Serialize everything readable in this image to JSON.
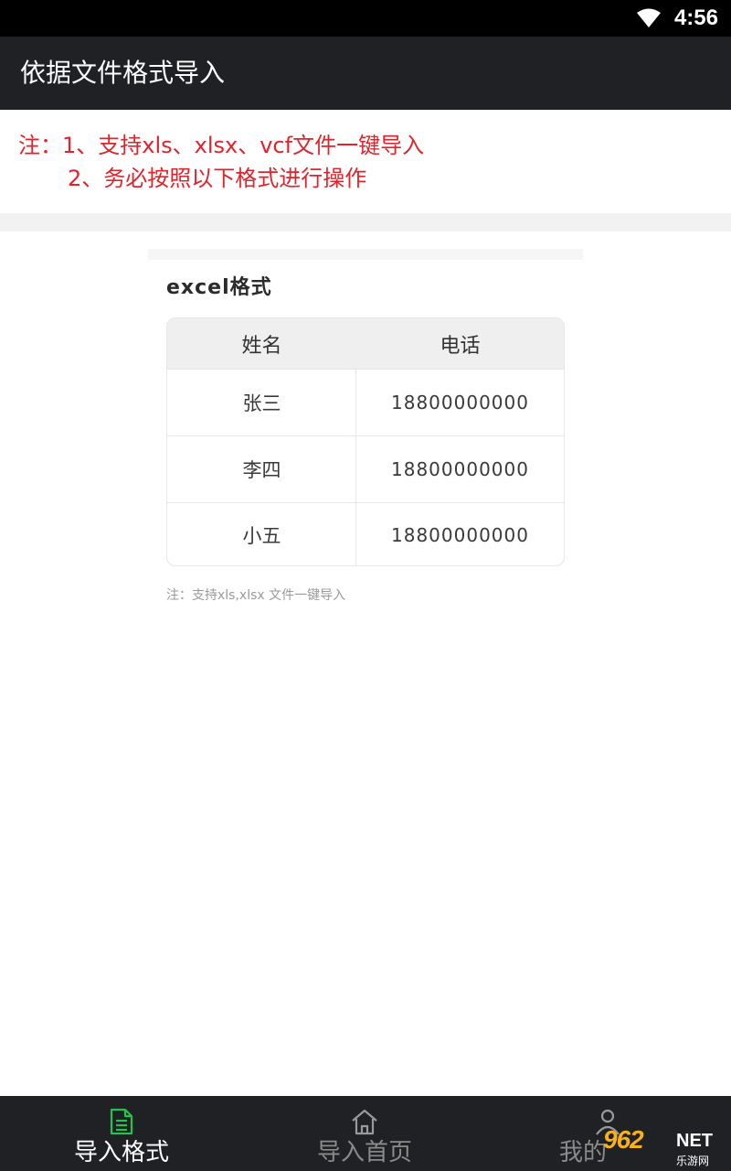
{
  "status_bar": {
    "time": "4:56",
    "wifi_icon": "wifi-icon"
  },
  "app_bar": {
    "title": "依据文件格式导入"
  },
  "notes": {
    "line1": "注：1、支持xls、xlsx、vcf文件一键导入",
    "line2": "2、务必按照以下格式进行操作"
  },
  "format_card": {
    "heading": "excel格式",
    "columns": [
      "姓名",
      "电话"
    ],
    "rows": [
      {
        "name": "张三",
        "phone": "18800000000"
      },
      {
        "name": "李四",
        "phone": "18800000000"
      },
      {
        "name": "小五",
        "phone": "18800000000"
      }
    ],
    "footnote": "注：支持xls,xlsx 文件一键导入"
  },
  "bottom_nav": {
    "items": [
      {
        "label": "导入格式",
        "icon": "document-icon",
        "active": true
      },
      {
        "label": "导入首页",
        "icon": "home-icon",
        "active": false
      },
      {
        "label": "我的",
        "icon": "user-icon",
        "active": false
      }
    ]
  },
  "watermark": {
    "brand": "962",
    "net": "NET",
    "sub": "乐游网"
  },
  "colors": {
    "app_bar_bg": "#1f2125",
    "note_red": "#e0242b",
    "active_icon_green": "#27c24c"
  }
}
